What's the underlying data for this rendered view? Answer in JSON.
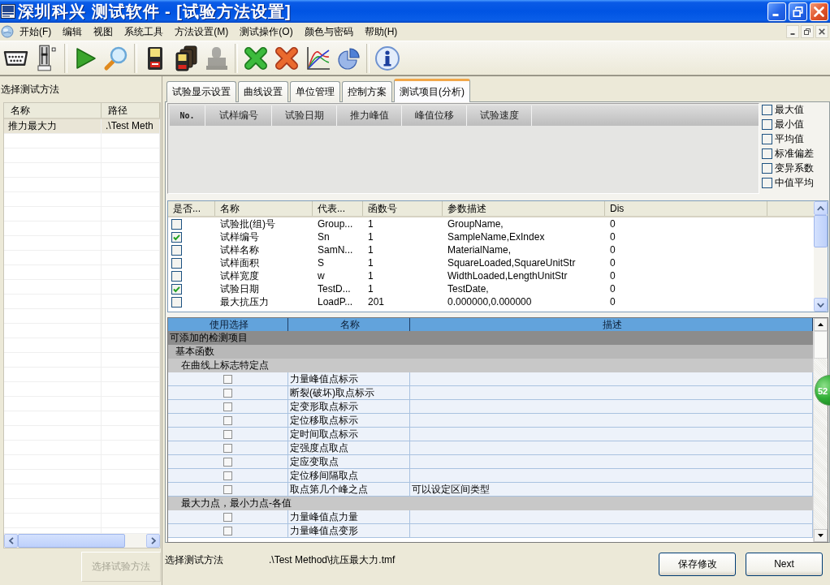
{
  "window": {
    "title": "深圳科兴 测试软件 - [试验方法设置]"
  },
  "menu": [
    "开始(F)",
    "编辑",
    "视图",
    "系统工具",
    "方法设置(M)",
    "测试操作(O)",
    "颜色与密码",
    "帮助(H)"
  ],
  "toolbar": {
    "groups": [
      {
        "buttons": [
          {
            "disabled": false
          },
          {
            "disabled": false
          }
        ]
      },
      {
        "buttons": [
          {
            "disabled": false
          },
          {
            "disabled": false
          }
        ]
      },
      {
        "buttons": [
          {
            "disabled": false
          },
          {
            "disabled": false
          },
          {
            "disabled": true
          }
        ]
      },
      {
        "buttons": [
          {
            "disabled": false
          },
          {
            "disabled": false
          },
          {
            "disabled": false
          },
          {
            "disabled": false
          }
        ]
      },
      {
        "buttons": [
          {
            "disabled": false
          }
        ]
      }
    ]
  },
  "method_panel": {
    "title": "选择测试方法",
    "columns": [
      "名称",
      "路径"
    ],
    "rows": [
      {
        "cells": [
          "推力最大力",
          ".\\Test Meth"
        ],
        "selected": true
      }
    ],
    "button": {
      "label": "选择试验方法",
      "disabled": true
    }
  },
  "tabs": [
    {
      "label": "试验显示设置",
      "selected": false
    },
    {
      "label": "曲线设置",
      "selected": false
    },
    {
      "label": "单位管理",
      "selected": false
    },
    {
      "label": "控制方案",
      "selected": false
    },
    {
      "label": "测试项目(分析)",
      "selected": true
    }
  ],
  "results_table": {
    "columns": [
      "No.",
      "试样编号",
      "试验日期",
      "推力峰值",
      "峰值位移",
      "试验速度"
    ]
  },
  "statistics": [
    {
      "label": "最大值",
      "checked": false
    },
    {
      "label": "最小值",
      "checked": false
    },
    {
      "label": "平均值",
      "checked": false
    },
    {
      "label": "标准偏差",
      "checked": false
    },
    {
      "label": "变异系数",
      "checked": false
    },
    {
      "label": "中值平均",
      "checked": false
    }
  ],
  "parameter_table": {
    "check_header": "是否...",
    "columns": [
      "名称",
      "代表...",
      "函数号",
      "参数描述",
      "Dis"
    ],
    "rows": [
      {
        "checked": false,
        "cells": [
          "试验批(组)号",
          "Group...",
          "1",
          "GroupName,",
          "0"
        ]
      },
      {
        "checked": true,
        "cells": [
          "试样编号",
          "Sn",
          "1",
          "SampleName,ExIndex",
          "0"
        ]
      },
      {
        "checked": false,
        "cells": [
          "试样名称",
          "SamN...",
          "1",
          "MaterialName,",
          "0"
        ]
      },
      {
        "checked": false,
        "cells": [
          "试样面积",
          "S",
          "1",
          "SquareLoaded,SquareUnitStr",
          "0"
        ]
      },
      {
        "checked": false,
        "cells": [
          "试样宽度",
          "w",
          "1",
          "WidthLoaded,LengthUnitStr",
          "0"
        ]
      },
      {
        "checked": true,
        "cells": [
          "试验日期",
          "TestD...",
          "1",
          "TestDate,",
          "0"
        ]
      },
      {
        "checked": false,
        "cells": [
          "最大抗压力",
          "LoadP...",
          "201",
          "0.000000,0.000000",
          "0"
        ]
      }
    ]
  },
  "items_table": {
    "columns": [
      "使用选择",
      "名称",
      "描述"
    ],
    "groups": [
      {
        "title": "可添加的检测项目",
        "children": [
          {
            "title": "基本函数",
            "children": [
              {
                "title": "在曲线上标志特定点",
                "items": [
                  {
                    "name": "力量峰值点标示",
                    "checked": false
                  },
                  {
                    "name": "断裂(破坏)取点标示",
                    "checked": false
                  },
                  {
                    "name": "定变形取点标示",
                    "checked": false
                  },
                  {
                    "name": "定位移取点标示",
                    "checked": false
                  },
                  {
                    "name": "定时间取点标示",
                    "checked": false
                  },
                  {
                    "name": "定强度点取点",
                    "checked": false
                  },
                  {
                    "name": "定应变取点",
                    "checked": false
                  },
                  {
                    "name": "定位移间隔取点",
                    "checked": false
                  },
                  {
                    "name": "取点第几个峰之点",
                    "description": "可以设定区间类型",
                    "checked": false
                  }
                ]
              },
              {
                "title": "最大力点，最小力点-各值",
                "items": [
                  {
                    "name": "力量峰值点力量",
                    "checked": false
                  },
                  {
                    "name": "力量峰值点变形",
                    "checked": false
                  }
                ]
              }
            ]
          }
        ]
      }
    ]
  },
  "status": {
    "label": "选择测试方法",
    "path": ".\\Test Method\\抗压最大力.tmf"
  },
  "buttons": [
    {
      "label": "保存修改"
    },
    {
      "label": "Next"
    }
  ],
  "badge": {
    "text": "52"
  }
}
